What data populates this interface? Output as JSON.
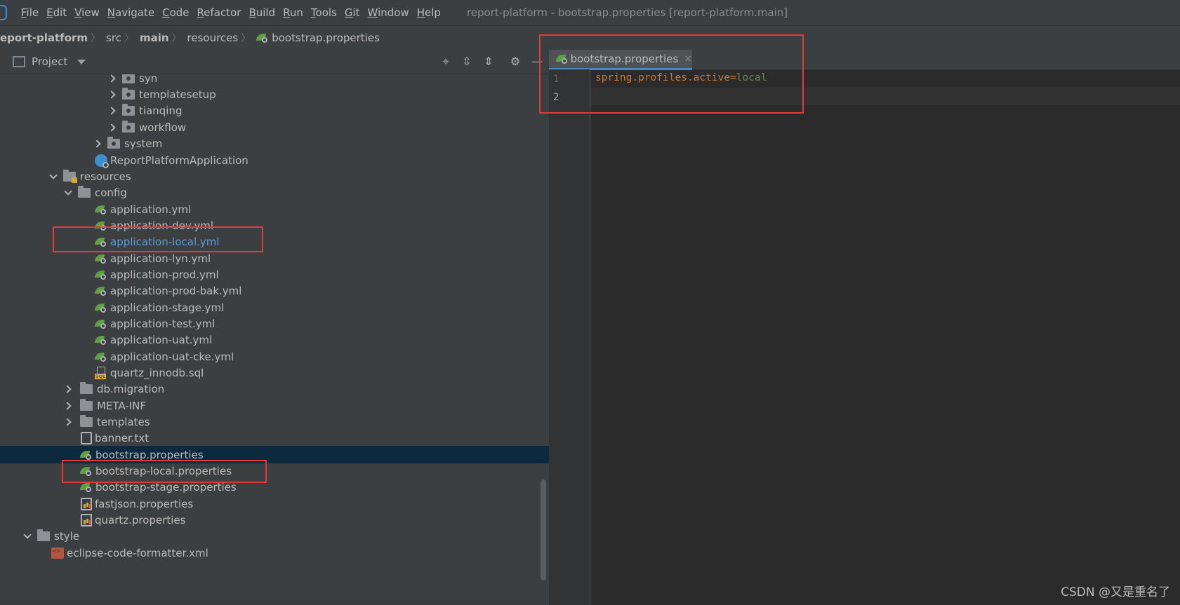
{
  "menu": [
    {
      "label": "File",
      "accel": "F",
      "rest": "ile"
    },
    {
      "label": "Edit",
      "accel": "E",
      "rest": "dit"
    },
    {
      "label": "View",
      "accel": "V",
      "rest": "iew"
    },
    {
      "label": "Navigate",
      "accel": "N",
      "rest": "avigate"
    },
    {
      "label": "Code",
      "accel": "C",
      "rest": "ode"
    },
    {
      "label": "Refactor",
      "accel": "R",
      "rest": "efactor"
    },
    {
      "label": "Build",
      "accel": "B",
      "rest": "uild"
    },
    {
      "label": "Run",
      "accel": "R",
      "rest": "un"
    },
    {
      "label": "Tools",
      "accel": "T",
      "rest": "ools"
    },
    {
      "label": "Git",
      "accel": "G",
      "rest": "it"
    },
    {
      "label": "Window",
      "accel": "W",
      "rest": "indow"
    },
    {
      "label": "Help",
      "accel": "H",
      "rest": "elp"
    }
  ],
  "window_title": "report-platform - bootstrap.properties [report-platform.main]",
  "breadcrumb": [
    "eport-platform",
    "src",
    "main",
    "resources",
    "bootstrap.properties"
  ],
  "project_panel": {
    "title": "Project"
  },
  "tree": [
    {
      "label": "syn",
      "icon": "package-folder-icon",
      "chevron": "right"
    },
    {
      "label": "templatesetup",
      "icon": "package-folder-icon",
      "chevron": "right"
    },
    {
      "label": "tianqing",
      "icon": "package-folder-icon",
      "chevron": "right"
    },
    {
      "label": "workflow",
      "icon": "package-folder-icon",
      "chevron": "right"
    },
    {
      "label": "system",
      "icon": "package-folder-icon",
      "chevron": "right"
    },
    {
      "label": "ReportPlatformApplication",
      "icon": "spring-app-icon",
      "chevron": ""
    },
    {
      "label": "resources",
      "icon": "resources-folder-icon",
      "chevron": "down"
    },
    {
      "label": "config",
      "icon": "folder-icon",
      "chevron": "down"
    },
    {
      "label": "application.yml",
      "icon": "spring-config-icon",
      "chevron": ""
    },
    {
      "label": "application-dev.yml",
      "icon": "spring-config-icon",
      "chevron": ""
    },
    {
      "label": "application-local.yml",
      "icon": "spring-config-icon",
      "chevron": ""
    },
    {
      "label": "application-lyn.yml",
      "icon": "spring-config-icon",
      "chevron": ""
    },
    {
      "label": "application-prod.yml",
      "icon": "spring-config-icon",
      "chevron": ""
    },
    {
      "label": "application-prod-bak.yml",
      "icon": "spring-config-icon",
      "chevron": ""
    },
    {
      "label": "application-stage.yml",
      "icon": "spring-config-icon",
      "chevron": ""
    },
    {
      "label": "application-test.yml",
      "icon": "spring-config-icon",
      "chevron": ""
    },
    {
      "label": "application-uat.yml",
      "icon": "spring-config-icon",
      "chevron": ""
    },
    {
      "label": "application-uat-cke.yml",
      "icon": "spring-config-icon",
      "chevron": ""
    },
    {
      "label": "quartz_innodb.sql",
      "icon": "sql-file-icon",
      "chevron": ""
    },
    {
      "label": "db.migration",
      "icon": "folder-icon",
      "chevron": "right"
    },
    {
      "label": "META-INF",
      "icon": "folder-icon",
      "chevron": "right"
    },
    {
      "label": "templates",
      "icon": "folder-icon",
      "chevron": "right"
    },
    {
      "label": "banner.txt",
      "icon": "text-file-icon",
      "chevron": ""
    },
    {
      "label": "bootstrap.properties",
      "icon": "spring-config-icon",
      "chevron": ""
    },
    {
      "label": "bootstrap-local.properties",
      "icon": "spring-config-icon",
      "chevron": ""
    },
    {
      "label": "bootstrap-stage.properties",
      "icon": "spring-config-icon",
      "chevron": ""
    },
    {
      "label": "fastjson.properties",
      "icon": "properties-file-icon",
      "chevron": ""
    },
    {
      "label": "quartz.properties",
      "icon": "properties-file-icon",
      "chevron": ""
    },
    {
      "label": "style",
      "icon": "folder-icon",
      "chevron": "down"
    },
    {
      "label": "eclipse-code-formatter.xml",
      "icon": "xml-file-icon",
      "chevron": ""
    }
  ],
  "editor": {
    "tab_label": "bootstrap.properties",
    "close_glyph": "×",
    "line_numbers": [
      "1",
      "2"
    ],
    "code": {
      "key": "spring.profiles.active",
      "eq": "=",
      "value": "local"
    }
  },
  "watermark": "CSDN @又是重名了",
  "colors": {
    "accent": "#4a88c7",
    "highlight_box": "#e03a3a",
    "link_text": "#5b9bd5",
    "code_key": "#cc7832",
    "code_value": "#6a8759"
  }
}
